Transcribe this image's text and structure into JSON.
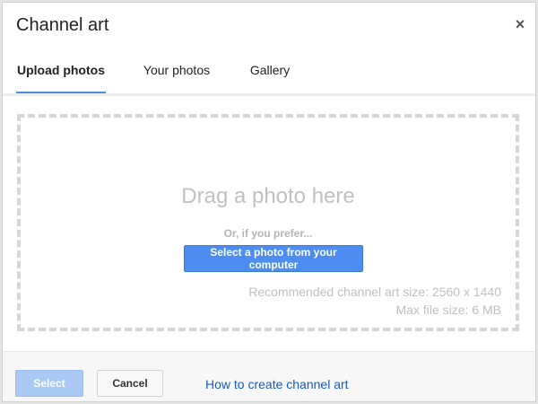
{
  "dialog": {
    "title": "Channel art",
    "close_glyph": "×"
  },
  "tabs": [
    {
      "label": "Upload photos",
      "active": true
    },
    {
      "label": "Your photos",
      "active": false
    },
    {
      "label": "Gallery",
      "active": false
    }
  ],
  "dropzone": {
    "drag_text": "Drag a photo here",
    "or_text": "Or, if you prefer...",
    "select_button_label": "Select a photo from your computer",
    "recommended_text": "Recommended channel art size: 2560 x 1440",
    "max_size_text": "Max file size: 6 MB"
  },
  "footer": {
    "select_label": "Select",
    "cancel_label": "Cancel",
    "help_link": "How to create channel art"
  },
  "colors": {
    "accent": "#4d8cf0",
    "link": "#1a5bc2",
    "disabled_button": "#a9c9f4"
  },
  "icons": {
    "close": "close-icon"
  }
}
